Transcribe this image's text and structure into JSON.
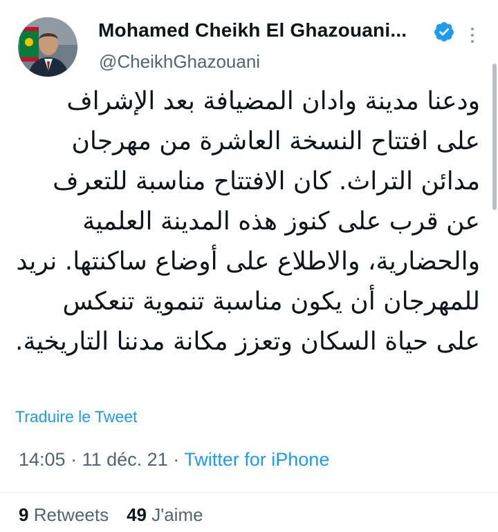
{
  "author": {
    "display_name": "Mohamed Cheikh El Ghazouani...",
    "handle": "@CheikhGhazouani",
    "verified_icon": "verified-badge-icon",
    "avatar_icon": "profile-avatar"
  },
  "tweet": {
    "text": "ودعنا مدينة وادان المضيافة بعد الإشراف على افتتاح النسخة العاشرة من  مهرجان مدائن التراث. كان الافتتاح مناسبة للتعرف عن قرب على كنوز هذه المدينة العلمية والحضارية، والاطلاع على أوضاع ساكنتها. نريد للمهرجان أن يكون مناسبة تنموية تنعكس على حياة السكان وتعزز مكانة مدننا التاريخية.",
    "translate_label": "Traduire le Tweet",
    "time": "14:05",
    "separator": "·",
    "date": "11 déc. 21",
    "source": "Twitter for iPhone"
  },
  "stats": {
    "retweets_count": "9",
    "retweets_label": "Retweets",
    "likes_count": "49",
    "likes_label": "J'aime"
  },
  "colors": {
    "accent": "#1d9bf0",
    "secondary_text": "#536471",
    "primary_text": "#0f1419"
  }
}
